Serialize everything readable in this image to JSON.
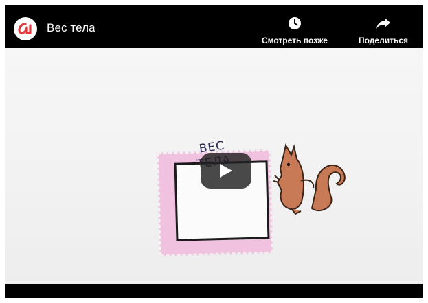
{
  "header": {
    "title": "Вес тела",
    "channel_logo_icon": "brand-logo-icon",
    "brand_color": "#e03a3e"
  },
  "actions": {
    "watch_later": {
      "label": "Смотреть позже",
      "icon": "clock-icon"
    },
    "share": {
      "label": "Поделиться",
      "icon": "share-arrow-icon"
    }
  },
  "player": {
    "play_icon": "play-icon"
  },
  "illustration": {
    "line1": "ВЕС",
    "line2": "ТЕЛА",
    "stamp_color": "#f1c2df",
    "squirrel_color": "#c87a56"
  }
}
